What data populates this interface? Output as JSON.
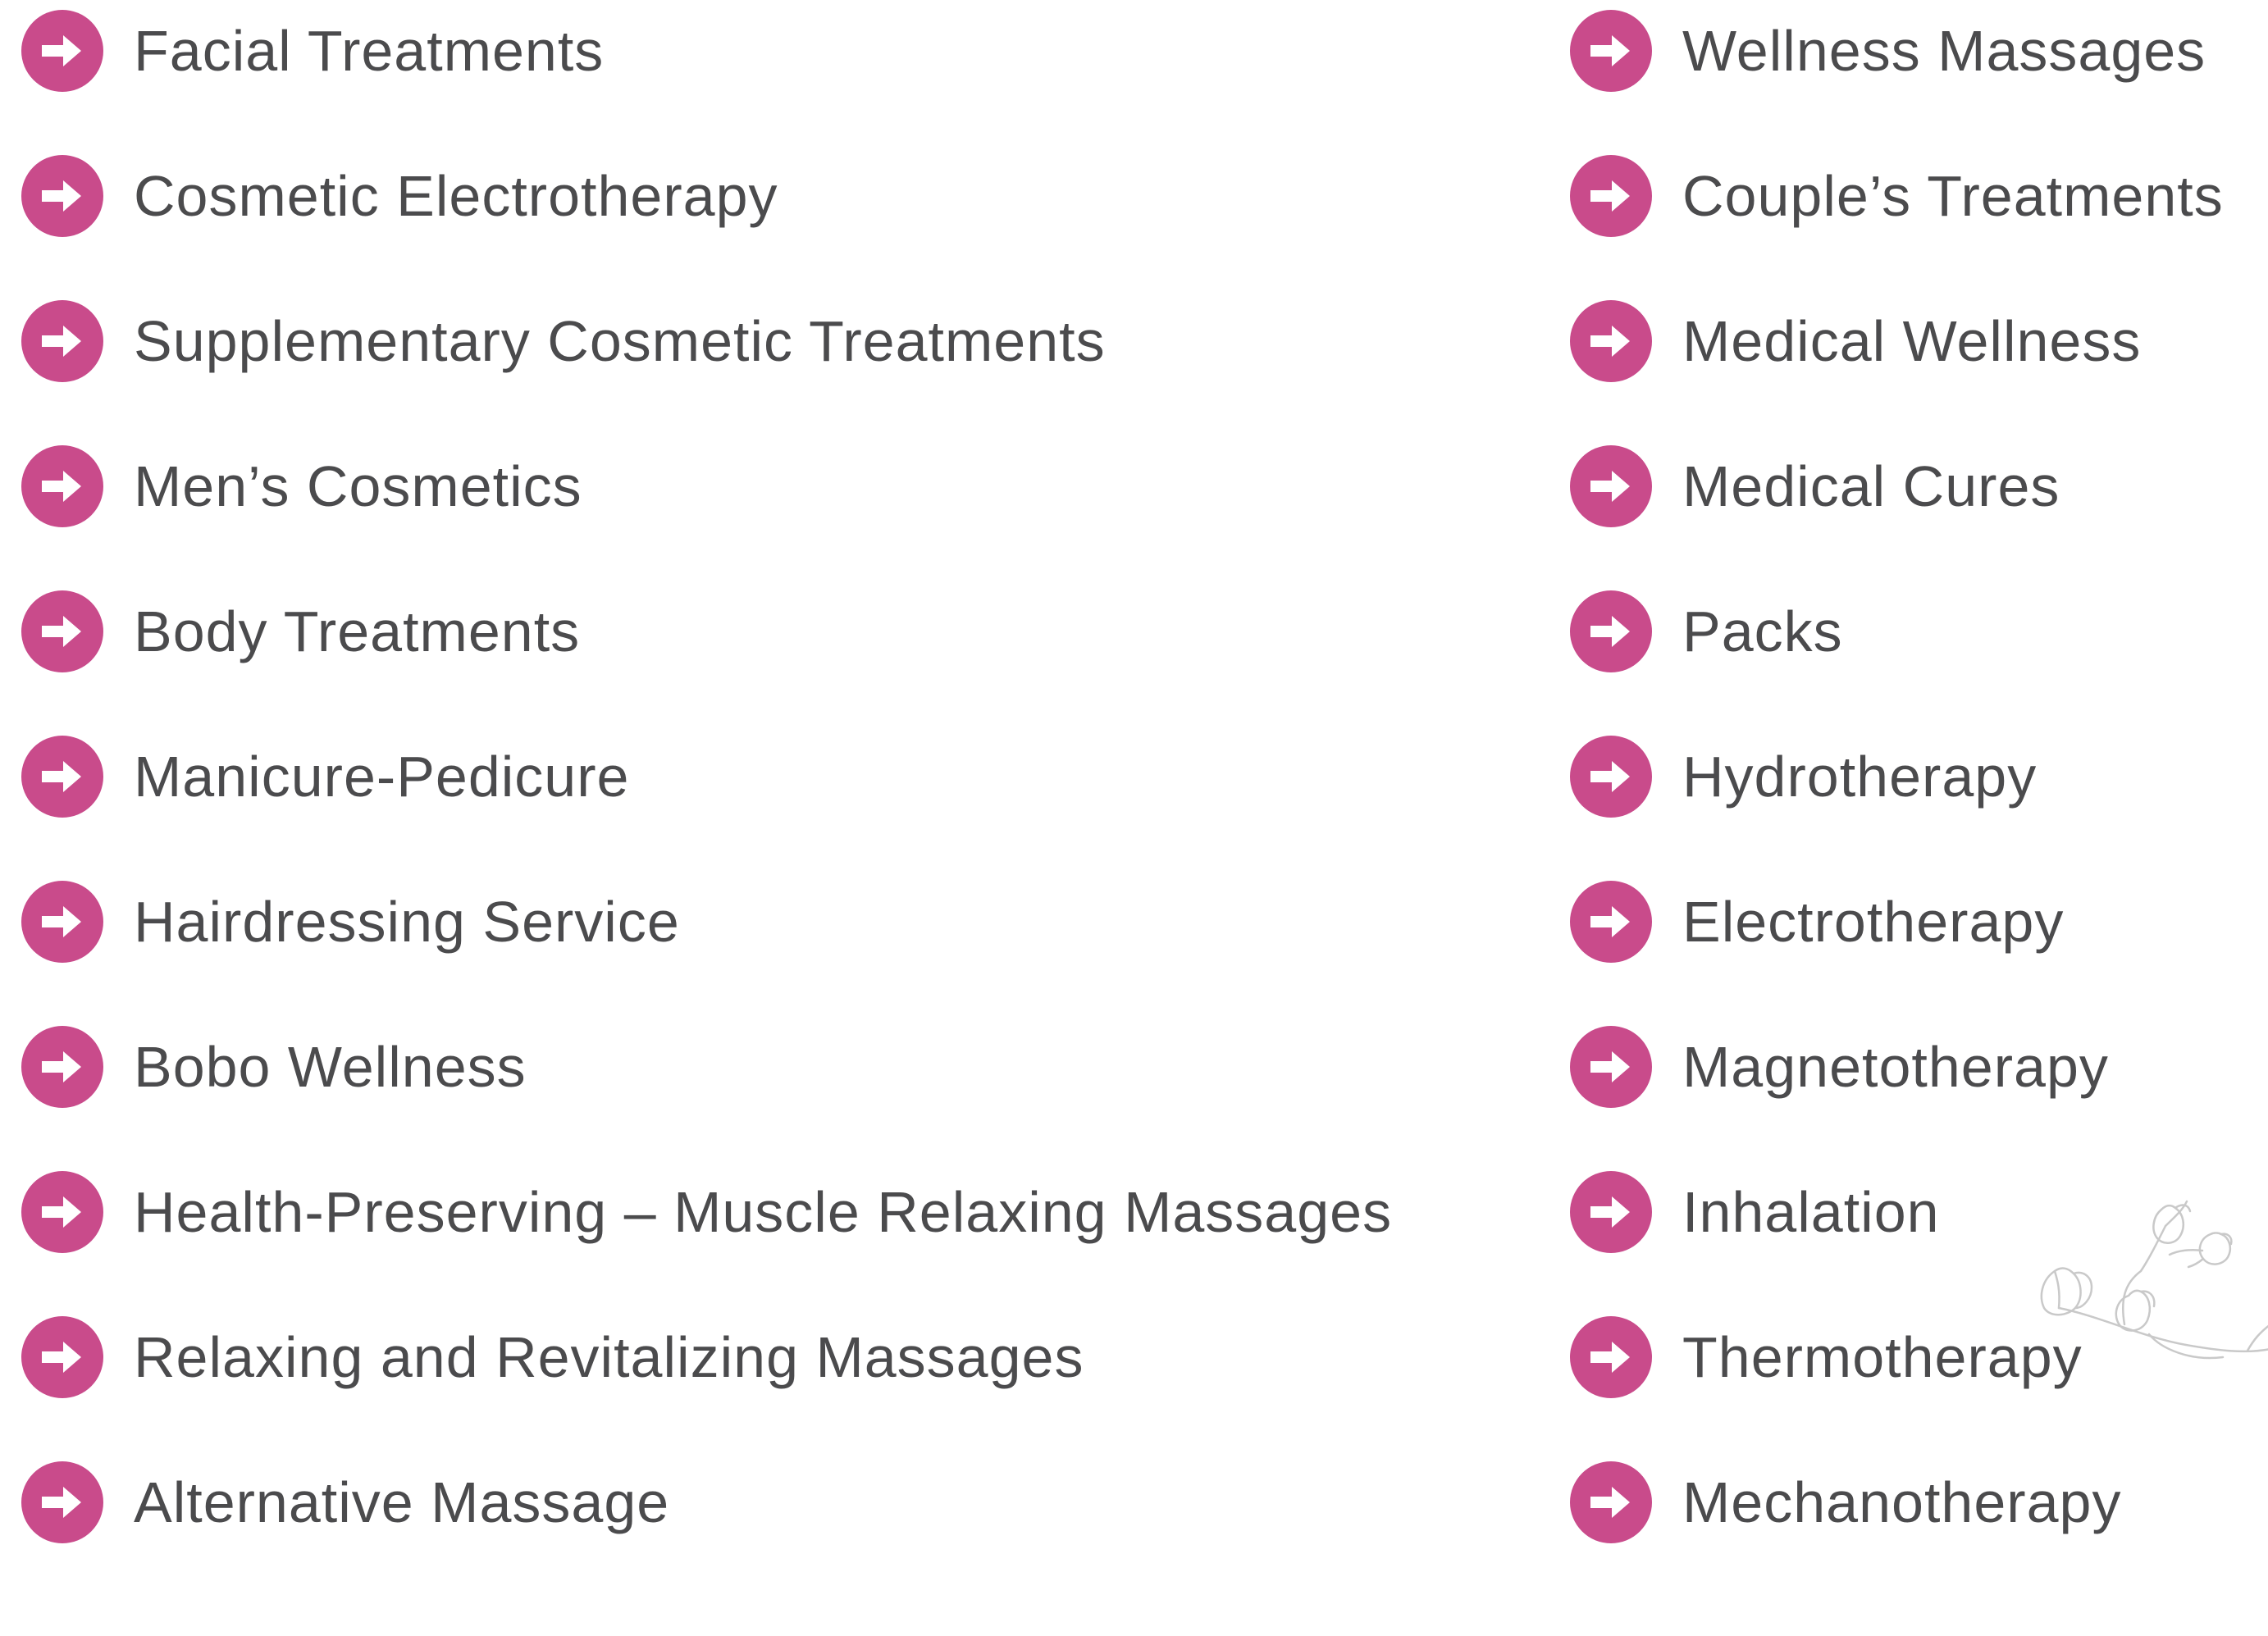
{
  "colors": {
    "accent": "#c94b8b",
    "text": "#4b4b4d",
    "background": "#ffffff"
  },
  "icons": {
    "bullet": "arrow-right-circle-icon",
    "decoration": "flower-branch-icon"
  },
  "left_column": [
    {
      "label": "Facial Treatments"
    },
    {
      "label": "Cosmetic Electrotherapy"
    },
    {
      "label": "Supplementary Cosmetic Treatments"
    },
    {
      "label": "Men’s Cosmetics"
    },
    {
      "label": "Body Treatments"
    },
    {
      "label": "Manicure-Pedicure"
    },
    {
      "label": "Hairdressing Service"
    },
    {
      "label": "Bobo Wellness"
    },
    {
      "label": "Health-Preserving – Muscle Relaxing Massages"
    },
    {
      "label": "Relaxing and Revitalizing Massages"
    },
    {
      "label": "Alternative Massage"
    }
  ],
  "right_column": [
    {
      "label": "Wellness Massages"
    },
    {
      "label": "Couple’s Treatments"
    },
    {
      "label": "Medical Wellness"
    },
    {
      "label": "Medical Cures"
    },
    {
      "label": "Packs"
    },
    {
      "label": "Hydrotherapy"
    },
    {
      "label": "Electrotherapy"
    },
    {
      "label": "Magnetotherapy"
    },
    {
      "label": "Inhalation"
    },
    {
      "label": "Thermotherapy"
    },
    {
      "label": "Mechanotherapy"
    }
  ]
}
